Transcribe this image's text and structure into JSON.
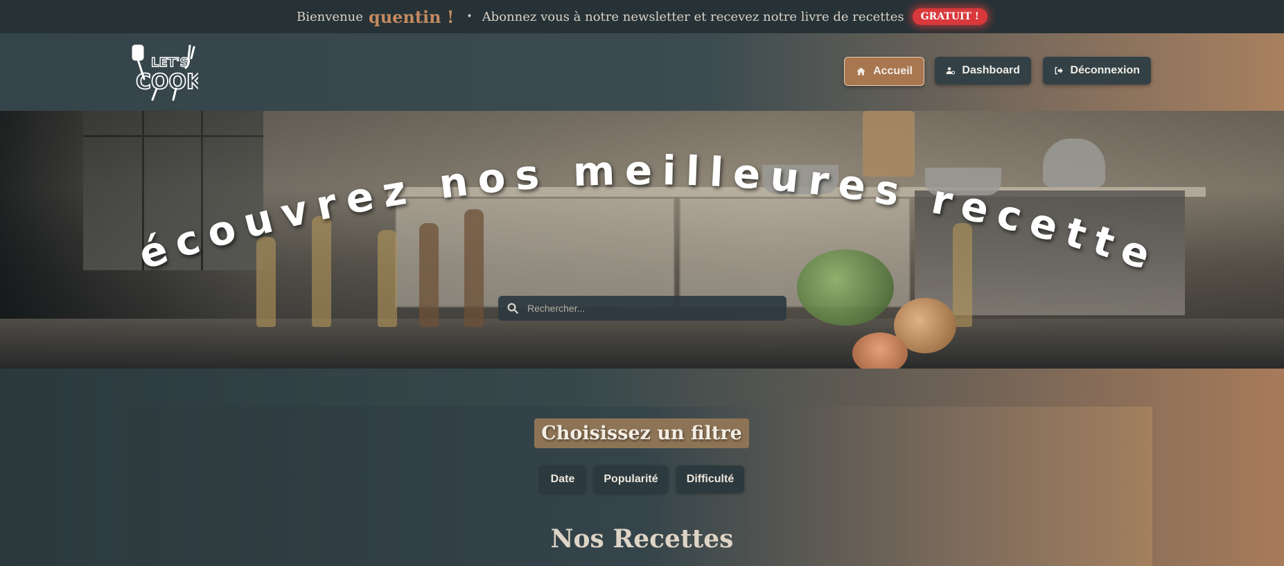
{
  "topbar": {
    "welcome": "Bienvenue",
    "username": "quentin !",
    "separator": "•",
    "promo": "Abonnez vous à notre newsletter et recevez notre livre de recettes",
    "badge": "GRATUIT !"
  },
  "header": {
    "logo_text": "LET'S COOK",
    "nav": [
      {
        "label": "Accueil",
        "icon": "home-icon",
        "active": true
      },
      {
        "label": "Dashboard",
        "icon": "user-cog-icon",
        "active": false
      },
      {
        "label": "Déconnexion",
        "icon": "logout-icon",
        "active": false
      }
    ]
  },
  "hero": {
    "title": "Découvrez nos meilleures recettes",
    "search_placeholder": "Rechercher..."
  },
  "filters": {
    "title": "Choisissez un filtre",
    "options": [
      "Date",
      "Popularité",
      "Difficulté"
    ]
  },
  "recipes": {
    "title": "Nos Recettes"
  },
  "colors": {
    "accent": "#a8764f",
    "badge": "#d9393c",
    "username": "#c48a5f"
  }
}
